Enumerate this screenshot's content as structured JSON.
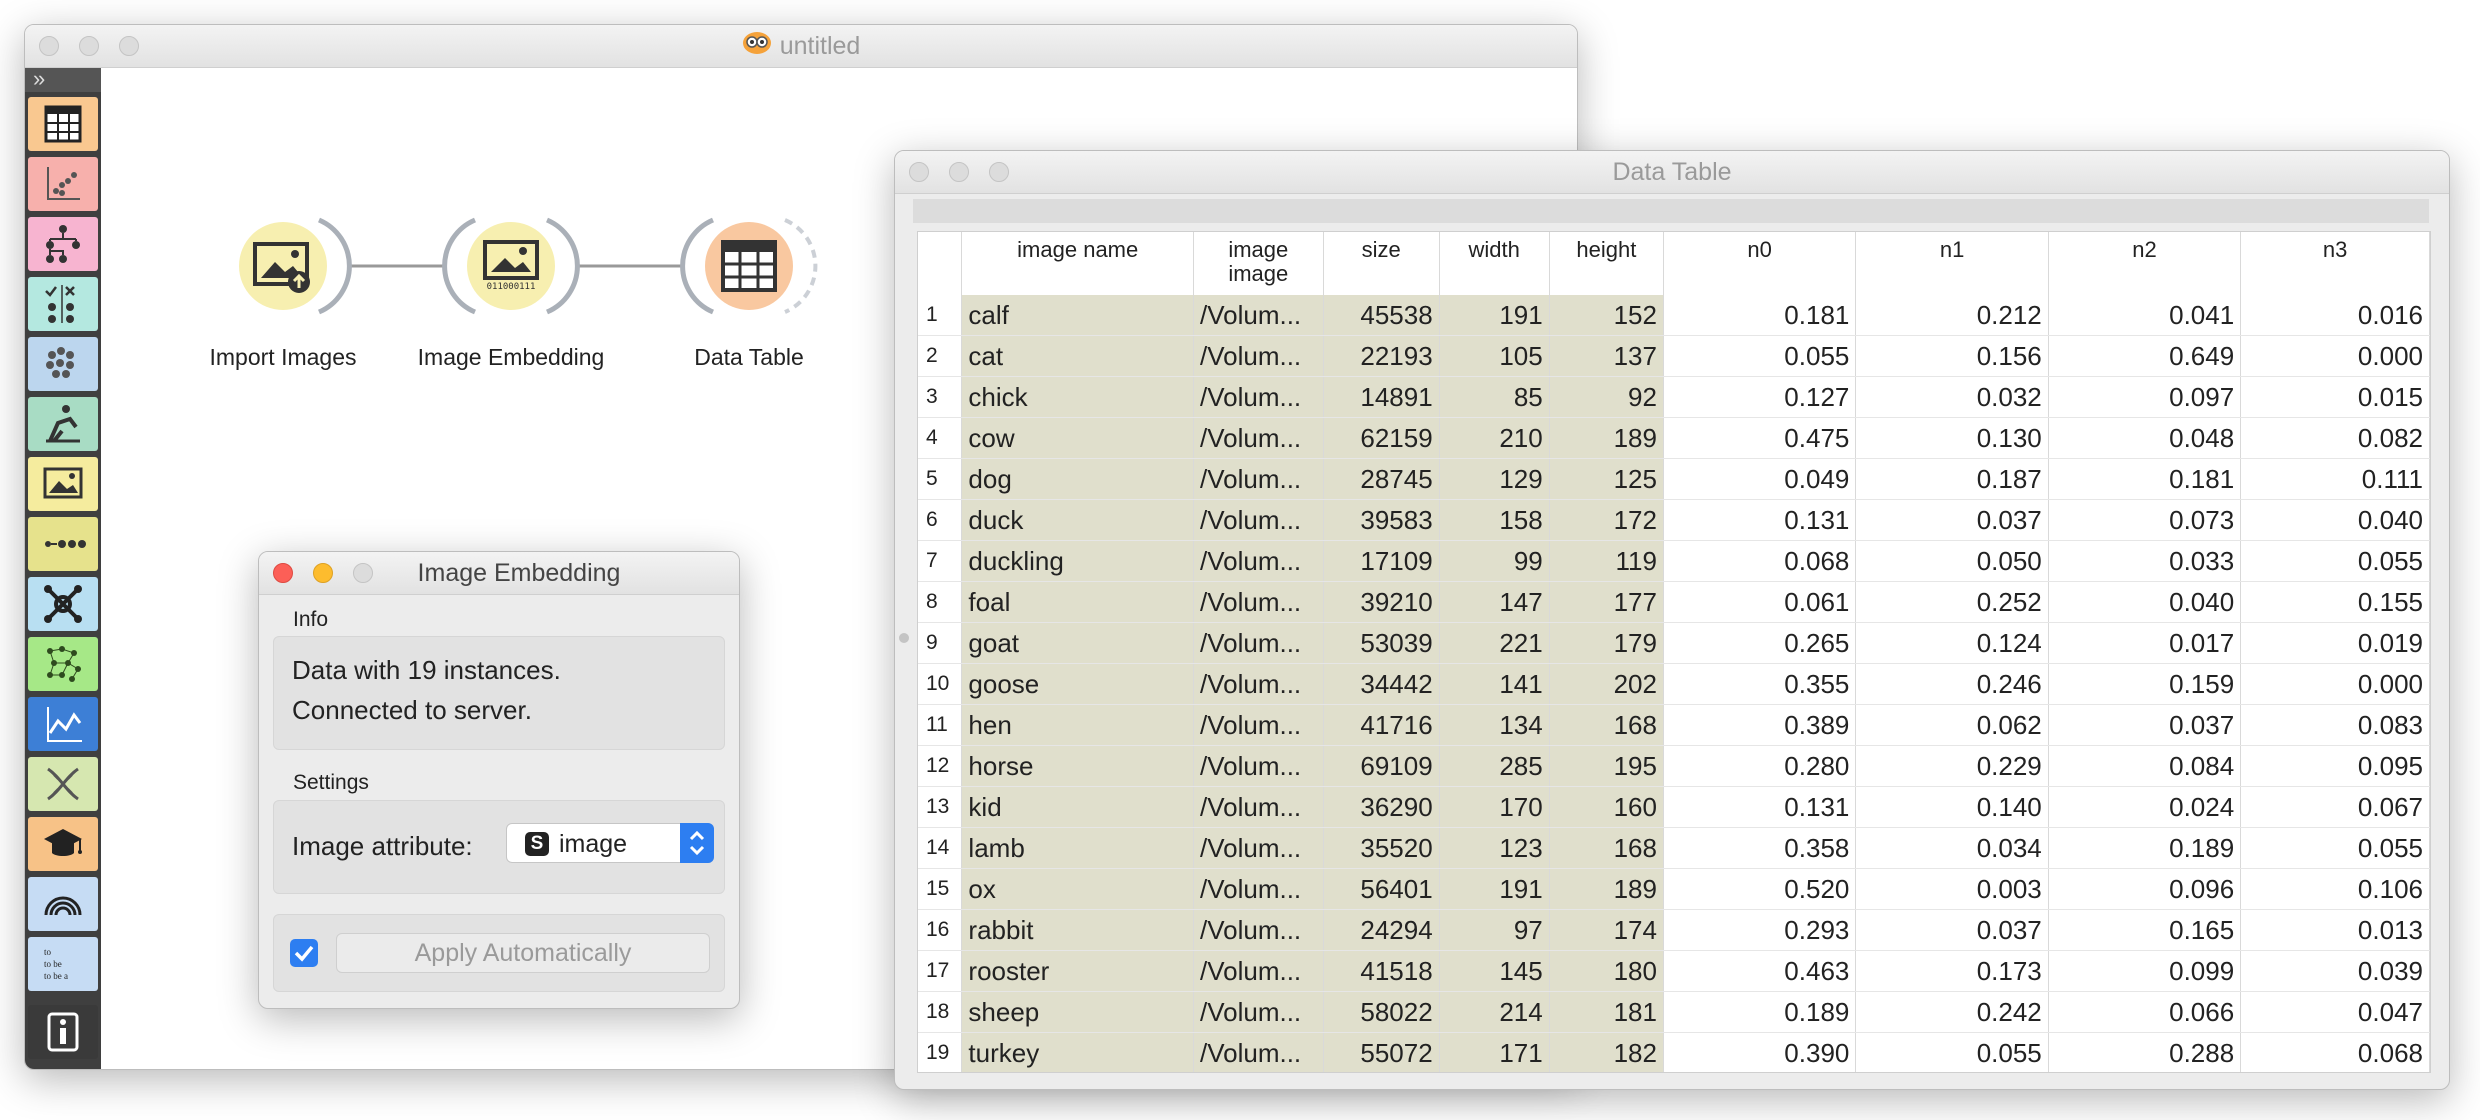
{
  "main_window": {
    "title": "untitled"
  },
  "sidebar": {
    "collapse_glyph": "»",
    "categories": [
      {
        "name": "data-icon",
        "color": "#f9c890"
      },
      {
        "name": "visualize-icon",
        "color": "#f7b0ac"
      },
      {
        "name": "model-icon",
        "color": "#f7b4d0"
      },
      {
        "name": "evaluate-icon",
        "color": "#b4e8e0"
      },
      {
        "name": "unsupervised-icon",
        "color": "#bcd6ee"
      },
      {
        "name": "image-analytics-icon",
        "color": "#a8dcc4"
      },
      {
        "name": "image-viewer-icon",
        "color": "#f5ec9e"
      },
      {
        "name": "bioinformatics-icon",
        "color": "#e6e28c"
      },
      {
        "name": "network-icon",
        "color": "#b8dff2"
      },
      {
        "name": "geo-icon",
        "color": "#a6e887"
      },
      {
        "name": "timeseries-icon",
        "color": "#3d7fd6"
      },
      {
        "name": "dna-icon",
        "color": "#d6e7b0"
      },
      {
        "name": "educational-icon",
        "color": "#f7c287"
      },
      {
        "name": "spectroscopy-icon",
        "color": "#c6dcf4"
      },
      {
        "name": "text-mining-icon",
        "color": "#c6dcf4"
      },
      {
        "name": "info-icon",
        "color": "#3a3a3a"
      }
    ]
  },
  "workflow": {
    "nodes": [
      {
        "label": "Import Images"
      },
      {
        "label": "Image Embedding",
        "caption": "011000111"
      },
      {
        "label": "Data Table"
      }
    ]
  },
  "embedding_dialog": {
    "title": "Image Embedding",
    "info_title": "Info",
    "info_line1": "Data with 19 instances.",
    "info_line2": "Connected to server.",
    "settings_title": "Settings",
    "attribute_label": "Image attribute:",
    "attribute_badge": "S",
    "attribute_value": "image",
    "apply_label": "Apply Automatically",
    "apply_checked": true
  },
  "data_table": {
    "title": "Data Table",
    "columns": [
      {
        "key": "name",
        "label": "image name"
      },
      {
        "key": "image",
        "label": "image",
        "label2": "image"
      },
      {
        "key": "size",
        "label": "size"
      },
      {
        "key": "width",
        "label": "width"
      },
      {
        "key": "height",
        "label": "height"
      },
      {
        "key": "n0",
        "label": "n0"
      },
      {
        "key": "n1",
        "label": "n1"
      },
      {
        "key": "n2",
        "label": "n2"
      },
      {
        "key": "n3",
        "label": "n3"
      }
    ],
    "rows": [
      [
        "1",
        "calf",
        "/Volum...",
        "45538",
        "191",
        "152",
        "0.181",
        "0.212",
        "0.041",
        "0.016"
      ],
      [
        "2",
        "cat",
        "/Volum...",
        "22193",
        "105",
        "137",
        "0.055",
        "0.156",
        "0.649",
        "0.000"
      ],
      [
        "3",
        "chick",
        "/Volum...",
        "14891",
        "85",
        "92",
        "0.127",
        "0.032",
        "0.097",
        "0.015"
      ],
      [
        "4",
        "cow",
        "/Volum...",
        "62159",
        "210",
        "189",
        "0.475",
        "0.130",
        "0.048",
        "0.082"
      ],
      [
        "5",
        "dog",
        "/Volum...",
        "28745",
        "129",
        "125",
        "0.049",
        "0.187",
        "0.181",
        "0.111"
      ],
      [
        "6",
        "duck",
        "/Volum...",
        "39583",
        "158",
        "172",
        "0.131",
        "0.037",
        "0.073",
        "0.040"
      ],
      [
        "7",
        "duckling",
        "/Volum...",
        "17109",
        "99",
        "119",
        "0.068",
        "0.050",
        "0.033",
        "0.055"
      ],
      [
        "8",
        "foal",
        "/Volum...",
        "39210",
        "147",
        "177",
        "0.061",
        "0.252",
        "0.040",
        "0.155"
      ],
      [
        "9",
        "goat",
        "/Volum...",
        "53039",
        "221",
        "179",
        "0.265",
        "0.124",
        "0.017",
        "0.019"
      ],
      [
        "10",
        "goose",
        "/Volum...",
        "34442",
        "141",
        "202",
        "0.355",
        "0.246",
        "0.159",
        "0.000"
      ],
      [
        "11",
        "hen",
        "/Volum...",
        "41716",
        "134",
        "168",
        "0.389",
        "0.062",
        "0.037",
        "0.083"
      ],
      [
        "12",
        "horse",
        "/Volum...",
        "69109",
        "285",
        "195",
        "0.280",
        "0.229",
        "0.084",
        "0.095"
      ],
      [
        "13",
        "kid",
        "/Volum...",
        "36290",
        "170",
        "160",
        "0.131",
        "0.140",
        "0.024",
        "0.067"
      ],
      [
        "14",
        "lamb",
        "/Volum...",
        "35520",
        "123",
        "168",
        "0.358",
        "0.034",
        "0.189",
        "0.055"
      ],
      [
        "15",
        "ox",
        "/Volum...",
        "56401",
        "191",
        "189",
        "0.520",
        "0.003",
        "0.096",
        "0.106"
      ],
      [
        "16",
        "rabbit",
        "/Volum...",
        "24294",
        "97",
        "174",
        "0.293",
        "0.037",
        "0.165",
        "0.013"
      ],
      [
        "17",
        "rooster",
        "/Volum...",
        "41518",
        "145",
        "180",
        "0.463",
        "0.173",
        "0.099",
        "0.039"
      ],
      [
        "18",
        "sheep",
        "/Volum...",
        "58022",
        "214",
        "181",
        "0.189",
        "0.242",
        "0.066",
        "0.047"
      ],
      [
        "19",
        "turkey",
        "/Volum...",
        "55072",
        "171",
        "182",
        "0.390",
        "0.055",
        "0.288",
        "0.068"
      ]
    ]
  }
}
